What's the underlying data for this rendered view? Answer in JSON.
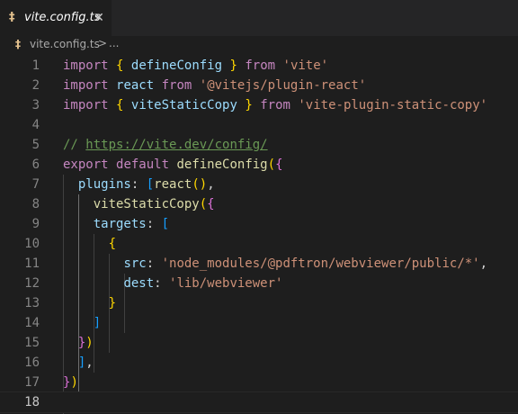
{
  "tab": {
    "icon_glyph": "‡",
    "filename": "vite.config.ts",
    "close_glyph": "✕"
  },
  "breadcrumb": {
    "icon_glyph": "‡",
    "file": "vite.config.ts",
    "separator": ">",
    "more": "..."
  },
  "colors": {
    "editor_bg": "#1e1e1e",
    "tabbar_bg": "#252526",
    "keyword": "#c586c0",
    "variable": "#9cdcfe",
    "function": "#dcdcaa",
    "string": "#ce9178",
    "comment": "#6a9955",
    "bracket_1": "#ffd700",
    "bracket_2": "#da70d6",
    "bracket_3": "#179fff"
  },
  "editor": {
    "lines": [
      {
        "n": "1",
        "tokens": [
          [
            "kw",
            "import"
          ],
          [
            "p",
            " "
          ],
          [
            "b1",
            "{"
          ],
          [
            "p",
            " "
          ],
          [
            "var",
            "defineConfig"
          ],
          [
            "p",
            " "
          ],
          [
            "b1",
            "}"
          ],
          [
            "p",
            " "
          ],
          [
            "kw",
            "from"
          ],
          [
            "p",
            " "
          ],
          [
            "str",
            "'vite'"
          ]
        ]
      },
      {
        "n": "2",
        "tokens": [
          [
            "kw",
            "import"
          ],
          [
            "p",
            " "
          ],
          [
            "var",
            "react"
          ],
          [
            "p",
            " "
          ],
          [
            "kw",
            "from"
          ],
          [
            "p",
            " "
          ],
          [
            "str",
            "'@vitejs/plugin-react'"
          ]
        ]
      },
      {
        "n": "3",
        "tokens": [
          [
            "kw",
            "import"
          ],
          [
            "p",
            " "
          ],
          [
            "b1",
            "{"
          ],
          [
            "p",
            " "
          ],
          [
            "var",
            "viteStaticCopy"
          ],
          [
            "p",
            " "
          ],
          [
            "b1",
            "}"
          ],
          [
            "p",
            " "
          ],
          [
            "kw",
            "from"
          ],
          [
            "p",
            " "
          ],
          [
            "str",
            "'vite-plugin-static-copy'"
          ]
        ]
      },
      {
        "n": "4",
        "tokens": []
      },
      {
        "n": "5",
        "tokens": [
          [
            "cm",
            "// "
          ],
          [
            "cm-link",
            "https://vite.dev/config/"
          ]
        ]
      },
      {
        "n": "6",
        "tokens": [
          [
            "kw",
            "export"
          ],
          [
            "p",
            " "
          ],
          [
            "kw",
            "default"
          ],
          [
            "p",
            " "
          ],
          [
            "fn",
            "defineConfig"
          ],
          [
            "b1",
            "("
          ],
          [
            "b2",
            "{"
          ]
        ]
      },
      {
        "n": "7",
        "tokens": [
          [
            "p",
            "  "
          ],
          [
            "prop",
            "plugins"
          ],
          [
            "p",
            ": "
          ],
          [
            "b3",
            "["
          ],
          [
            "fn",
            "react"
          ],
          [
            "b1",
            "()"
          ],
          [
            "p",
            ","
          ]
        ]
      },
      {
        "n": "8",
        "tokens": [
          [
            "p",
            "    "
          ],
          [
            "fn",
            "viteStaticCopy"
          ],
          [
            "b1",
            "("
          ],
          [
            "b2",
            "{"
          ]
        ]
      },
      {
        "n": "9",
        "tokens": [
          [
            "p",
            "    "
          ],
          [
            "prop",
            "targets"
          ],
          [
            "p",
            ": "
          ],
          [
            "b3",
            "["
          ]
        ]
      },
      {
        "n": "10",
        "tokens": [
          [
            "p",
            "      "
          ],
          [
            "b1",
            "{"
          ]
        ]
      },
      {
        "n": "11",
        "tokens": [
          [
            "p",
            "        "
          ],
          [
            "prop",
            "src"
          ],
          [
            "p",
            ": "
          ],
          [
            "str",
            "'node_modules/@pdftron/webviewer/public/*'"
          ],
          [
            "p",
            ","
          ]
        ]
      },
      {
        "n": "12",
        "tokens": [
          [
            "p",
            "        "
          ],
          [
            "prop",
            "dest"
          ],
          [
            "p",
            ": "
          ],
          [
            "str",
            "'lib/webviewer'"
          ]
        ]
      },
      {
        "n": "13",
        "tokens": [
          [
            "p",
            "      "
          ],
          [
            "b1",
            "}"
          ]
        ]
      },
      {
        "n": "14",
        "tokens": [
          [
            "p",
            "    "
          ],
          [
            "b3",
            "]"
          ]
        ]
      },
      {
        "n": "15",
        "tokens": [
          [
            "p",
            "  "
          ],
          [
            "b2",
            "}"
          ],
          [
            "b1",
            ")"
          ]
        ]
      },
      {
        "n": "16",
        "tokens": [
          [
            "p",
            "  "
          ],
          [
            "b3",
            "]"
          ],
          [
            "p",
            ","
          ]
        ]
      },
      {
        "n": "17",
        "tokens": [
          [
            "b2",
            "}"
          ],
          [
            "b1",
            ")"
          ]
        ]
      },
      {
        "n": "18",
        "tokens": []
      }
    ]
  }
}
